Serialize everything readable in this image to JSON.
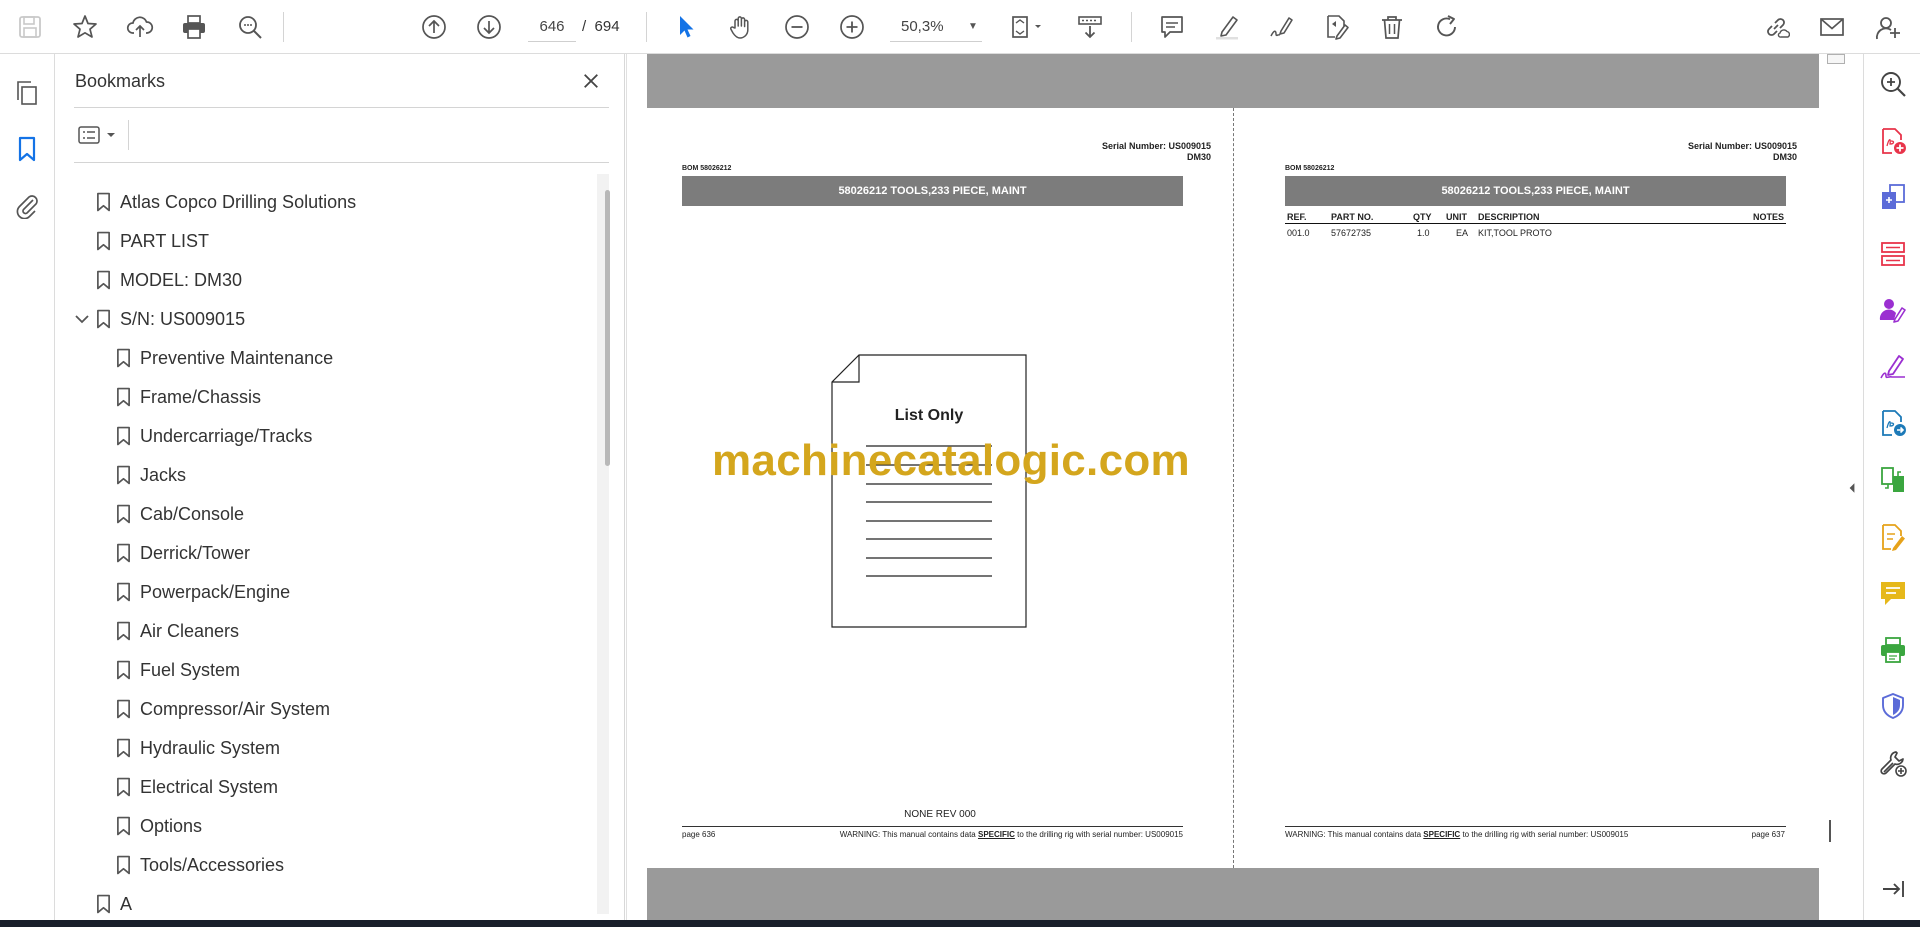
{
  "toolbar": {
    "icons": [
      "save-icon",
      "star-icon",
      "upload-icon",
      "print-icon",
      "search-zoom-icon",
      "previous-page-icon",
      "next-page-icon",
      "page-input",
      "zoom-out-icon",
      "zoom-in-icon",
      "zoom-dropdown",
      "select-cursor-icon",
      "hand-icon",
      "fit-page-icon",
      "scroll-mode-icon",
      "comment-icon",
      "highlight-icon",
      "sign-icon",
      "edit-pdf-icon",
      "delete-icon",
      "rotate-icon",
      "share-link-icon",
      "email-icon",
      "account-icon"
    ],
    "current_page": "646",
    "page_separator": "/",
    "total_pages": "694",
    "zoom": "50,3%"
  },
  "left_rail": {
    "items": [
      "page-thumbnails-icon",
      "bookmarks-icon",
      "attachments-icon"
    ],
    "active": "bookmarks-icon"
  },
  "bookmarks": {
    "title": "Bookmarks",
    "items": [
      {
        "label": "Atlas Copco Drilling Solutions",
        "level": 0
      },
      {
        "label": "PART LIST",
        "level": 0
      },
      {
        "label": "MODEL: DM30",
        "level": 0
      },
      {
        "label": "S/N: US009015",
        "level": 0,
        "expanded": true
      },
      {
        "label": "Preventive Maintenance",
        "level": 1
      },
      {
        "label": "Frame/Chassis",
        "level": 1
      },
      {
        "label": "Undercarriage/Tracks",
        "level": 1
      },
      {
        "label": "Jacks",
        "level": 1
      },
      {
        "label": "Cab/Console",
        "level": 1
      },
      {
        "label": "Derrick/Tower",
        "level": 1
      },
      {
        "label": "Powerpack/Engine",
        "level": 1
      },
      {
        "label": "Air Cleaners",
        "level": 1
      },
      {
        "label": "Fuel System",
        "level": 1
      },
      {
        "label": "Compressor/Air System",
        "level": 1
      },
      {
        "label": "Hydraulic System",
        "level": 1
      },
      {
        "label": "Electrical System",
        "level": 1
      },
      {
        "label": "Options",
        "level": 1
      },
      {
        "label": "Tools/Accessories",
        "level": 1
      },
      {
        "label": "A",
        "level": 0
      }
    ]
  },
  "left_page": {
    "serial_line": "Serial Number: US009015",
    "model_line": "DM30",
    "bom": "BOM 58026212",
    "title": "58026212 TOOLS,233 PIECE, MAINT",
    "list_only": "List Only",
    "revision": "NONE REV 000",
    "page_label": "page 636",
    "warning_prefix": "WARNING:  This manual contains data",
    "warning_emph": "SPECIFIC",
    "warning_suffix": "to the drilling rig with serial number: US009015"
  },
  "right_page": {
    "serial_line": "Serial Number: US009015",
    "model_line": "DM30",
    "bom": "BOM 58026212",
    "title": "58026212 TOOLS,233 PIECE, MAINT",
    "table": {
      "headers": [
        "REF.",
        "PART NO.",
        "QTY",
        "UNIT",
        "DESCRIPTION",
        "NOTES"
      ],
      "rows": [
        [
          "001.0",
          "57672735",
          "1.0",
          "EA",
          "KIT,TOOL PROTO",
          ""
        ]
      ]
    },
    "page_label": "page 637",
    "warning_prefix": "WARNING:  This manual contains data",
    "warning_emph": "SPECIFIC",
    "warning_suffix": "to the drilling rig with serial number: US009015"
  },
  "watermark": "machinecatalogic.com",
  "right_rail": {
    "items": [
      "search-tools-icon",
      "create-pdf-icon",
      "combine-files-icon",
      "organize-pages-icon",
      "request-signature-icon",
      "fill-sign-icon",
      "export-pdf-icon",
      "compare-files-icon",
      "edit-pdf-icon",
      "comment-icon",
      "print-production-icon",
      "protect-icon",
      "more-tools-icon",
      "expand-panel-icon"
    ]
  }
}
